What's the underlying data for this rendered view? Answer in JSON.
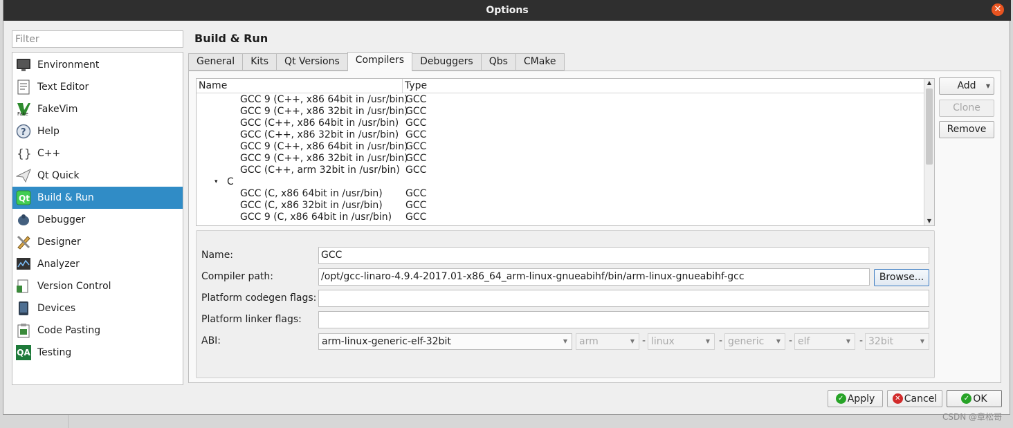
{
  "window": {
    "title": "Options",
    "close_glyph": "✕"
  },
  "filter": {
    "placeholder": "Filter",
    "value": ""
  },
  "categories": [
    {
      "label": "Environment",
      "icon": "monitor-icon"
    },
    {
      "label": "Text Editor",
      "icon": "text-document-icon"
    },
    {
      "label": "FakeVim",
      "icon": "fakevim-icon"
    },
    {
      "label": "Help",
      "icon": "help-icon"
    },
    {
      "label": "C++",
      "icon": "braces-icon"
    },
    {
      "label": "Qt Quick",
      "icon": "paper-plane-icon"
    },
    {
      "label": "Build & Run",
      "icon": "qt-build-icon",
      "selected": true
    },
    {
      "label": "Debugger",
      "icon": "bug-icon"
    },
    {
      "label": "Designer",
      "icon": "pencil-ruler-icon"
    },
    {
      "label": "Analyzer",
      "icon": "analyzer-icon"
    },
    {
      "label": "Version Control",
      "icon": "version-control-icon"
    },
    {
      "label": "Devices",
      "icon": "device-icon"
    },
    {
      "label": "Code Pasting",
      "icon": "clipboard-icon"
    },
    {
      "label": "Testing",
      "icon": "qa-icon",
      "icon_text": "QA"
    }
  ],
  "page_title": "Build & Run",
  "tabs": [
    "General",
    "Kits",
    "Qt Versions",
    "Compilers",
    "Debuggers",
    "Qbs",
    "CMake"
  ],
  "active_tab": "Compilers",
  "compiler_list": {
    "headers": {
      "name": "Name",
      "type": "Type"
    },
    "rows": [
      {
        "name": "GCC 9 (C++, x86 64bit in /usr/bin)",
        "type": "GCC"
      },
      {
        "name": "GCC 9 (C++, x86 32bit in /usr/bin)",
        "type": "GCC"
      },
      {
        "name": "GCC (C++, x86 64bit in /usr/bin)",
        "type": "GCC"
      },
      {
        "name": "GCC (C++, x86 32bit in /usr/bin)",
        "type": "GCC"
      },
      {
        "name": "GCC 9 (C++, x86 64bit in /usr/bin)",
        "type": "GCC"
      },
      {
        "name": "GCC 9 (C++, x86 32bit in /usr/bin)",
        "type": "GCC"
      },
      {
        "name": "GCC (C++, arm 32bit in /usr/bin)",
        "type": "GCC"
      },
      {
        "name": "C",
        "type": "",
        "group": true,
        "arrow": "▾"
      },
      {
        "name": "GCC (C, x86 64bit in /usr/bin)",
        "type": "GCC"
      },
      {
        "name": "GCC (C, x86 32bit in /usr/bin)",
        "type": "GCC"
      },
      {
        "name": "GCC 9 (C, x86 64bit in /usr/bin)",
        "type": "GCC"
      }
    ]
  },
  "side_buttons": {
    "add": "Add",
    "clone": "Clone",
    "remove": "Remove"
  },
  "details": {
    "name_label": "Name:",
    "name_value": "GCC",
    "compiler_path_label": "Compiler path:",
    "compiler_path_value": "/opt/gcc-linaro-4.9.4-2017.01-x86_64_arm-linux-gnueabihf/bin/arm-linux-gnueabihf-gcc",
    "browse_label": "Browse...",
    "codegen_label": "Platform codegen flags:",
    "codegen_value": "",
    "linker_label": "Platform linker flags:",
    "linker_value": "",
    "abi_label": "ABI:",
    "abi_value": "arm-linux-generic-elf-32bit",
    "abi_parts": [
      "arm",
      "linux",
      "generic",
      "elf",
      "32bit"
    ],
    "abi_separator": "-"
  },
  "footer": {
    "apply": "Apply",
    "cancel": "Cancel",
    "ok": "OK"
  },
  "watermark": "CSDN @章松哥",
  "colors": {
    "selection": "#308cc6",
    "titlebar": "#2f2f2f",
    "close": "#e95420",
    "ok_green": "#27a327",
    "cancel_red": "#d12b2b"
  }
}
